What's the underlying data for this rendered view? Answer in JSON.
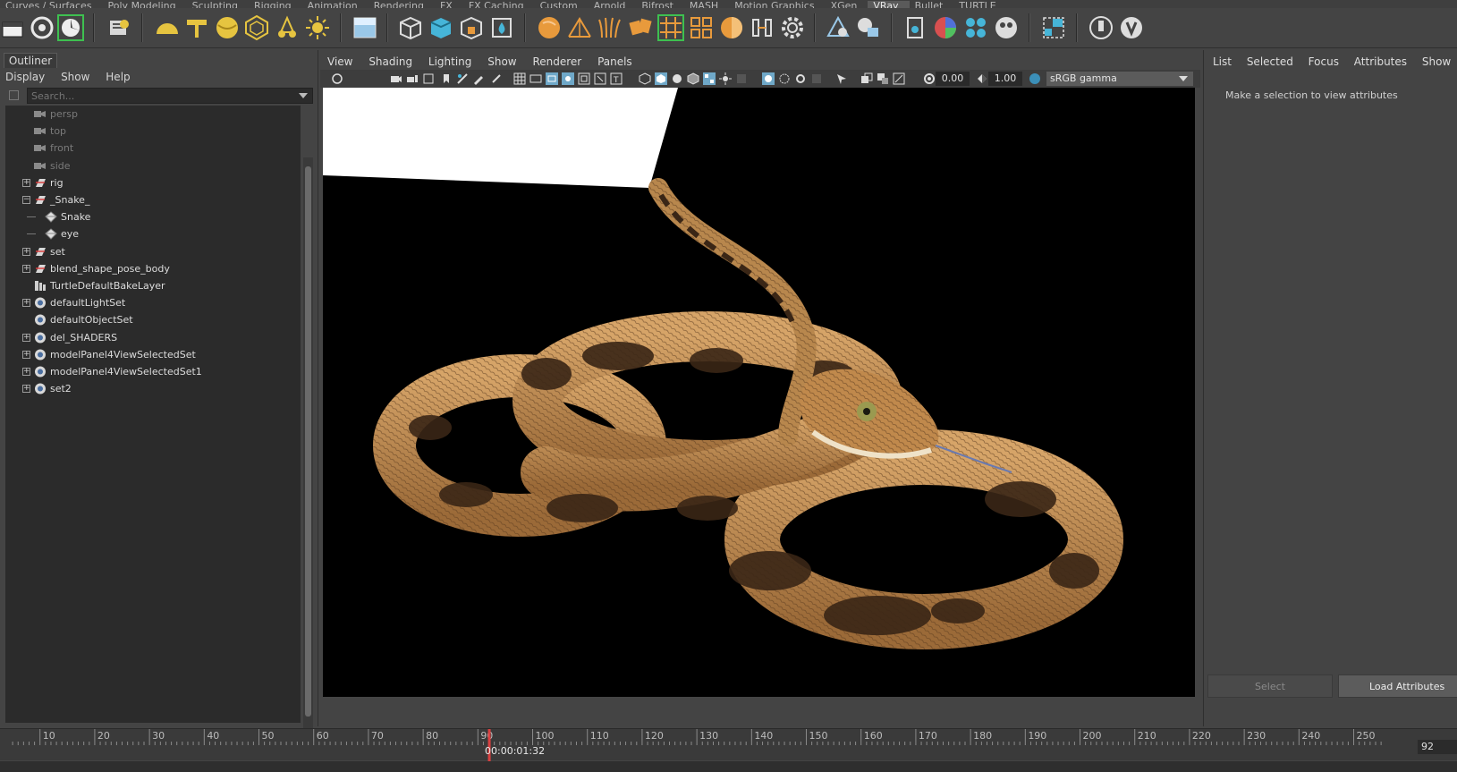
{
  "shelf_tabs": [
    "Curves / Surfaces",
    "Poly Modeling",
    "Sculpting",
    "Rigging",
    "Animation",
    "Rendering",
    "FX",
    "FX Caching",
    "Custom",
    "Arnold",
    "Bifrost",
    "MASH",
    "Motion Graphics",
    "XGen",
    "VRay",
    "Bullet",
    "TURTLE"
  ],
  "shelf_active_tab": "VRay",
  "outliner": {
    "tab_label": "Outliner",
    "menu": [
      "Display",
      "Show",
      "Help"
    ],
    "search_placeholder": "Search...",
    "items": [
      {
        "label": "persp",
        "icon": "camera-icon",
        "dim": true,
        "expandable": false,
        "indent": 0
      },
      {
        "label": "top",
        "icon": "camera-icon",
        "dim": true,
        "expandable": false,
        "indent": 0
      },
      {
        "label": "front",
        "icon": "camera-icon",
        "dim": true,
        "expandable": false,
        "indent": 0
      },
      {
        "label": "side",
        "icon": "camera-icon",
        "dim": true,
        "expandable": false,
        "indent": 0
      },
      {
        "label": "rig",
        "icon": "group-icon",
        "dim": false,
        "expandable": true,
        "expanded": false,
        "indent": 0
      },
      {
        "label": "_Snake_",
        "icon": "group-icon",
        "dim": false,
        "expandable": true,
        "expanded": true,
        "indent": 0
      },
      {
        "label": "Snake",
        "icon": "mesh-icon",
        "dim": false,
        "expandable": false,
        "indent": 1
      },
      {
        "label": "eye",
        "icon": "mesh-icon",
        "dim": false,
        "expandable": false,
        "indent": 1
      },
      {
        "label": "set",
        "icon": "group-icon",
        "dim": false,
        "expandable": true,
        "expanded": false,
        "indent": 0
      },
      {
        "label": "blend_shape_pose_body",
        "icon": "group-icon",
        "dim": false,
        "expandable": true,
        "expanded": false,
        "indent": 0
      },
      {
        "label": "TurtleDefaultBakeLayer",
        "icon": "bake-layer-icon",
        "dim": false,
        "expandable": false,
        "indent": 0
      },
      {
        "label": "defaultLightSet",
        "icon": "set-icon",
        "dim": false,
        "expandable": true,
        "expanded": false,
        "indent": 0
      },
      {
        "label": "defaultObjectSet",
        "icon": "set-icon",
        "dim": false,
        "expandable": false,
        "indent": 0
      },
      {
        "label": "del_SHADERS",
        "icon": "set-icon",
        "dim": false,
        "expandable": true,
        "expanded": false,
        "indent": 0
      },
      {
        "label": "modelPanel4ViewSelectedSet",
        "icon": "set-icon",
        "dim": false,
        "expandable": true,
        "expanded": false,
        "indent": 0
      },
      {
        "label": "modelPanel4ViewSelectedSet1",
        "icon": "set-icon",
        "dim": false,
        "expandable": true,
        "expanded": false,
        "indent": 0
      },
      {
        "label": "set2",
        "icon": "set-icon",
        "dim": false,
        "expandable": true,
        "expanded": false,
        "indent": 0
      }
    ]
  },
  "viewport": {
    "menu": [
      "View",
      "Shading",
      "Lighting",
      "Show",
      "Renderer",
      "Panels"
    ],
    "exposure": "0.00",
    "gamma": "1.00",
    "color_space": "sRGB gamma"
  },
  "attribute_editor": {
    "menu": [
      "List",
      "Selected",
      "Focus",
      "Attributes",
      "Show"
    ],
    "message": "Make a selection to view attributes",
    "select_button": "Select",
    "load_button": "Load Attributes"
  },
  "timeline": {
    "ticks": [
      "10",
      "20",
      "30",
      "40",
      "50",
      "60",
      "70",
      "80",
      "90",
      "100",
      "110",
      "120",
      "130",
      "140",
      "150",
      "160",
      "170",
      "180",
      "190",
      "200",
      "210",
      "220",
      "230",
      "240",
      "250"
    ],
    "timecode": "00:00:01:32",
    "current_frame": "92"
  },
  "colors": {
    "ui_bg": "#444444",
    "panel_dark": "#2b2b2b",
    "shelf_orange": "#e89a3c",
    "shelf_yellow": "#e6c440",
    "shelf_cyan": "#46b5d8",
    "snake_light": "#c9965a",
    "snake_dark": "#3a2616",
    "current_time": "#d94040"
  }
}
